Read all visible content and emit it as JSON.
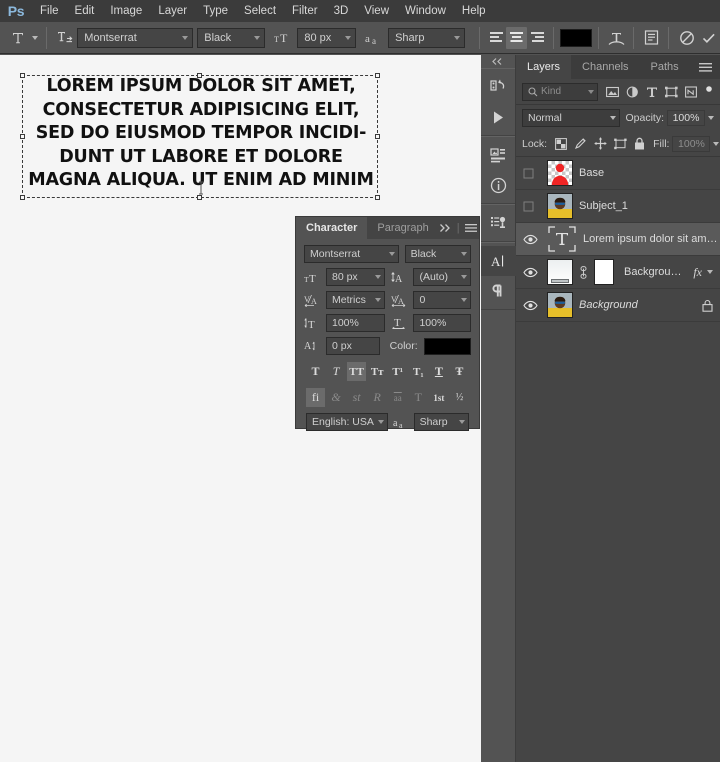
{
  "app": {
    "logo": "Ps"
  },
  "menubar": {
    "items": [
      "File",
      "Edit",
      "Image",
      "Layer",
      "Type",
      "Select",
      "Filter",
      "3D",
      "View",
      "Window",
      "Help"
    ]
  },
  "options_bar": {
    "tool_icon": "type-tool-icon",
    "orientation_icon": "toggle-text-orientation-icon",
    "font_family": "Montserrat",
    "font_style": "Black",
    "size_icon": "font-size-icon",
    "font_size": "80 px",
    "antialias_icon": "anti-alias-icon",
    "antialias": "Sharp",
    "align_left_icon": "align-left-icon",
    "align_center_icon": "align-center-icon",
    "align_right_icon": "align-right-icon",
    "color_swatch": "#000000",
    "warp_icon": "warp-text-icon",
    "panels_icon": "character-paragraph-panels-icon",
    "cancel_icon": "cancel-edits-icon",
    "commit_icon": "commit-edits-icon"
  },
  "canvas": {
    "background": "#f5f5f5",
    "text": "LOREM IPSUM DOLOR SIT AMET,\nCONSECTETUR ADIPISICING ELIT,\nSED DO EIUSMOD TEMPOR INCIDI-\nDUNT UT LABORE ET DOLORE\nMAGNA ALIQUA. UT ENIM AD MINIM",
    "text_color": "#111111",
    "selection": "text-bounding-box"
  },
  "character_panel": {
    "tabs": [
      {
        "label": "Character",
        "active": true
      },
      {
        "label": "Paragraph",
        "active": false
      }
    ],
    "expand_icon": "double-chevron-right-icon",
    "menu_icon": "panel-menu-icon",
    "font_family": "Montserrat",
    "font_style": "Black",
    "size_label_icon": "font-size-icon",
    "font_size": "80 px",
    "leading_label_icon": "leading-icon",
    "leading": "(Auto)",
    "kerning_label_icon": "kerning-icon",
    "kerning": "Metrics",
    "tracking_label_icon": "tracking-icon",
    "tracking": "0",
    "vscale_label_icon": "vertical-scale-icon",
    "vertical_scale": "100%",
    "hscale_label_icon": "horizontal-scale-icon",
    "horizontal_scale": "100%",
    "baseline_label_icon": "baseline-shift-icon",
    "baseline_shift": "0 px",
    "color_label": "Color:",
    "color_value": "#000000",
    "style_buttons": [
      {
        "name": "faux-bold-icon",
        "glyph": "T",
        "active": false
      },
      {
        "name": "faux-italic-icon",
        "glyph": "T",
        "active": false
      },
      {
        "name": "all-caps-icon",
        "glyph": "TT",
        "active": true
      },
      {
        "name": "small-caps-icon",
        "glyph": "Tт",
        "active": false
      },
      {
        "name": "superscript-icon",
        "glyph": "T¹",
        "active": false
      },
      {
        "name": "subscript-icon",
        "glyph": "T₁",
        "active": false
      },
      {
        "name": "underline-icon",
        "glyph": "T",
        "active": false
      },
      {
        "name": "strikethrough-icon",
        "glyph": "Ŧ",
        "active": false
      }
    ],
    "opentype_buttons": [
      {
        "name": "standard-ligatures-icon",
        "glyph": "fi",
        "active": true
      },
      {
        "name": "contextual-alternates-icon",
        "glyph": "&",
        "active": false
      },
      {
        "name": "discretionary-ligatures-icon",
        "glyph": "st",
        "active": false
      },
      {
        "name": "swash-icon",
        "glyph": "R",
        "active": false
      },
      {
        "name": "oldstyle-icon",
        "glyph": "aa",
        "active": false
      },
      {
        "name": "titling-alternates-icon",
        "glyph": "T",
        "active": false
      },
      {
        "name": "ordinals-icon",
        "glyph": "1st",
        "active": false
      },
      {
        "name": "fractions-icon",
        "glyph": "½",
        "active": false
      }
    ],
    "language": "English: USA",
    "antialias_icon": "anti-alias-icon",
    "antialias": "Sharp"
  },
  "dock_strip": {
    "collapse_icon": "collapse-panels-icon",
    "buttons": [
      {
        "name": "history-panel-icon",
        "active": false
      },
      {
        "name": "actions-panel-icon",
        "active": false
      },
      {
        "name": "adjustments-panel-icon",
        "active": false
      },
      {
        "name": "info-panel-icon",
        "active": false
      },
      {
        "name": "layer-comps-panel-icon",
        "active": false
      },
      {
        "name": "character-panel-icon",
        "active": true
      },
      {
        "name": "paragraph-panel-icon",
        "active": false
      }
    ]
  },
  "layers_panel": {
    "tabs": [
      {
        "label": "Layers",
        "active": true
      },
      {
        "label": "Channels",
        "active": false
      },
      {
        "label": "Paths",
        "active": false
      }
    ],
    "menu_icon": "panel-menu-icon",
    "filter_label": "Kind",
    "filter_search_icon": "search-icon",
    "filter_icons": [
      "filter-pixel-icon",
      "filter-adjustment-icon",
      "filter-type-icon",
      "filter-shape-icon",
      "filter-smartobject-icon",
      "filter-toggle-icon"
    ],
    "blend_mode": "Normal",
    "opacity_label": "Opacity:",
    "opacity_value": "100%",
    "lock_label": "Lock:",
    "lock_icons": [
      "lock-transparent-pixels-icon",
      "lock-image-pixels-icon",
      "lock-position-icon",
      "lock-artboard-nesting-icon",
      "lock-all-icon"
    ],
    "fill_label": "Fill:",
    "fill_value": "100%",
    "layers": [
      {
        "name": "Base",
        "visible": false,
        "selected": false,
        "thumb": "red-silhouette-thumbnail",
        "italic": false,
        "has_fx": false,
        "locked": false
      },
      {
        "name": "Subject_1",
        "visible": false,
        "selected": false,
        "thumb": "portrait-photo-thumbnail",
        "italic": false,
        "has_fx": false,
        "locked": false
      },
      {
        "name": "Lorem ipsum dolor sit amet...",
        "visible": true,
        "selected": true,
        "thumb": "type-layer-thumbnail",
        "italic": false,
        "has_fx": false,
        "locked": false
      },
      {
        "name": "Background Color",
        "visible": true,
        "selected": false,
        "thumb": "gradient-fill-thumbnail",
        "mask_thumb": "white-layer-mask-thumbnail",
        "link_icon": "mask-link-icon",
        "italic": false,
        "has_fx": true,
        "fx_label": "fx",
        "expand_icon": "chevron-down-icon",
        "locked": false
      },
      {
        "name": "Background",
        "visible": true,
        "selected": false,
        "thumb": "portrait-photo-thumbnail",
        "italic": true,
        "has_fx": false,
        "locked": true,
        "lock_icon": "lock-icon"
      }
    ]
  }
}
